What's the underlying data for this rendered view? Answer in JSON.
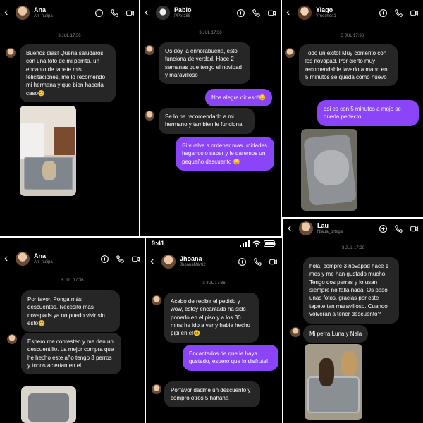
{
  "p1": {
    "name": "Ana",
    "user": "An_nulipa",
    "date": "3 JUL 17:36",
    "msg1": "Buenos dias! Queria saludaros con una foto de mi perrita, un encanto de tapete mis felicitaciones, me lo recomendo mi hermana y que bien hacerla caso😊"
  },
  "p2": {
    "name": "Pablo",
    "user": "PPerz88",
    "date": "3 JUL 17:36",
    "msg1": "Os doy la enhorabuena, esto funciona de verdad. Hace 2 semanas que tengo el novipad y maravilloso",
    "msg2": "Nos alegra oir eso!😊",
    "msg3": "Se lo he recomendado a mi hermano y tambien le funciona",
    "msg4": "Si vuelve a ordenar mas unidades haganoslo saber y le daremos un pequeño descuento 😊"
  },
  "p3": {
    "name": "Yiago",
    "user": "Ymochoe1",
    "date": "3 JUL 17:36",
    "msg1": "Todo un exito! Muy contento con los novapad. Por cierto muy recomendable lavarlo a mano en 5 minutos se queda como nuevo",
    "msg2": "asi es con 5 minutos a mojo se queda perfecto!"
  },
  "p4": {
    "name": "Ana",
    "user": "An_nulipa",
    "date": "3 JUL 17:36",
    "msg1": "Por favor, Ponga más descuentos. Necesito más novapads ya no puedo vivir sin esto😊",
    "msg2": "Espero me contesten y me den un descuentillo. La mejor compra que he hecho este año tengo 3 perros y todos aciertan en el"
  },
  "p5": {
    "time": "9:41",
    "name": "Jhoana",
    "user": "JhoanaMartí2",
    "date": "3 JUL 17:36",
    "msg1": "Acabo de recibir el pedido y wow, estoy encantada ha sido ponerlo en el piso y a los 30 mins he ido a ver y habia hecho pipi en el😊",
    "msg2": "Encantados de que le haya gustado, espero que lo disfrute!",
    "msg3": "Porfavor dadme un descuento y compro otros 5 hahaha"
  },
  "p6": {
    "name": "Lau",
    "user": "Nlaua_ortega",
    "date": "3 JUL 17:36",
    "msg1": "hola, compre 3 novapad hace 1 mes y me han gustado mucho. Tengo dos perras y lo usan siempre no falla nada. Os paso unas fotos, gracias por este tapete tan maravilloso. Cuando volveran a tener descuento?",
    "msg2": "Mi perra Luna y Nala"
  },
  "colors": {
    "bubble_gray": "#262626",
    "bubble_purple": "#8b44f7",
    "bg": "#000000"
  },
  "icons": [
    "back-chevron-icon",
    "threads-icon",
    "phone-icon",
    "video-icon"
  ]
}
